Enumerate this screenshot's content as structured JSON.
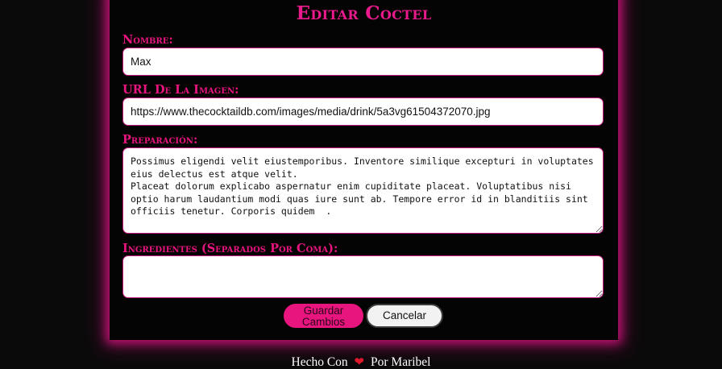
{
  "form": {
    "title": "Editar Coctel",
    "name": {
      "label": "Nombre:",
      "value": "Max"
    },
    "image_url": {
      "label": "URL De La Imagen:",
      "value": "https://www.thecocktaildb.com/images/media/drink/5a3vg61504372070.jpg"
    },
    "preparation": {
      "label": "Preparación:",
      "value": "Possimus eligendi velit eiustemporibus. Inventore similique excepturi in voluptates eius delectus est atque velit.\nPlaceat dolorum explicabo aspernatur enim cupiditate placeat. Voluptatibus nisi optio harum laudantium modi quas iure sunt ab. Tempore error id in blanditiis sint officiis tenetur. Corporis quidem  ."
    },
    "ingredients": {
      "label": "Ingredientes (Separados Por Coma):",
      "value": ""
    },
    "buttons": {
      "save_label": "Guardar Cambios",
      "cancel_label": "Cancelar"
    }
  },
  "footer": {
    "prefix": "Hecho Con",
    "heart_icon": "heart-icon",
    "suffix": "Por Maribel"
  },
  "colors": {
    "accent": "#e8157f",
    "background": "#0b0a0b",
    "card": "#050405"
  }
}
